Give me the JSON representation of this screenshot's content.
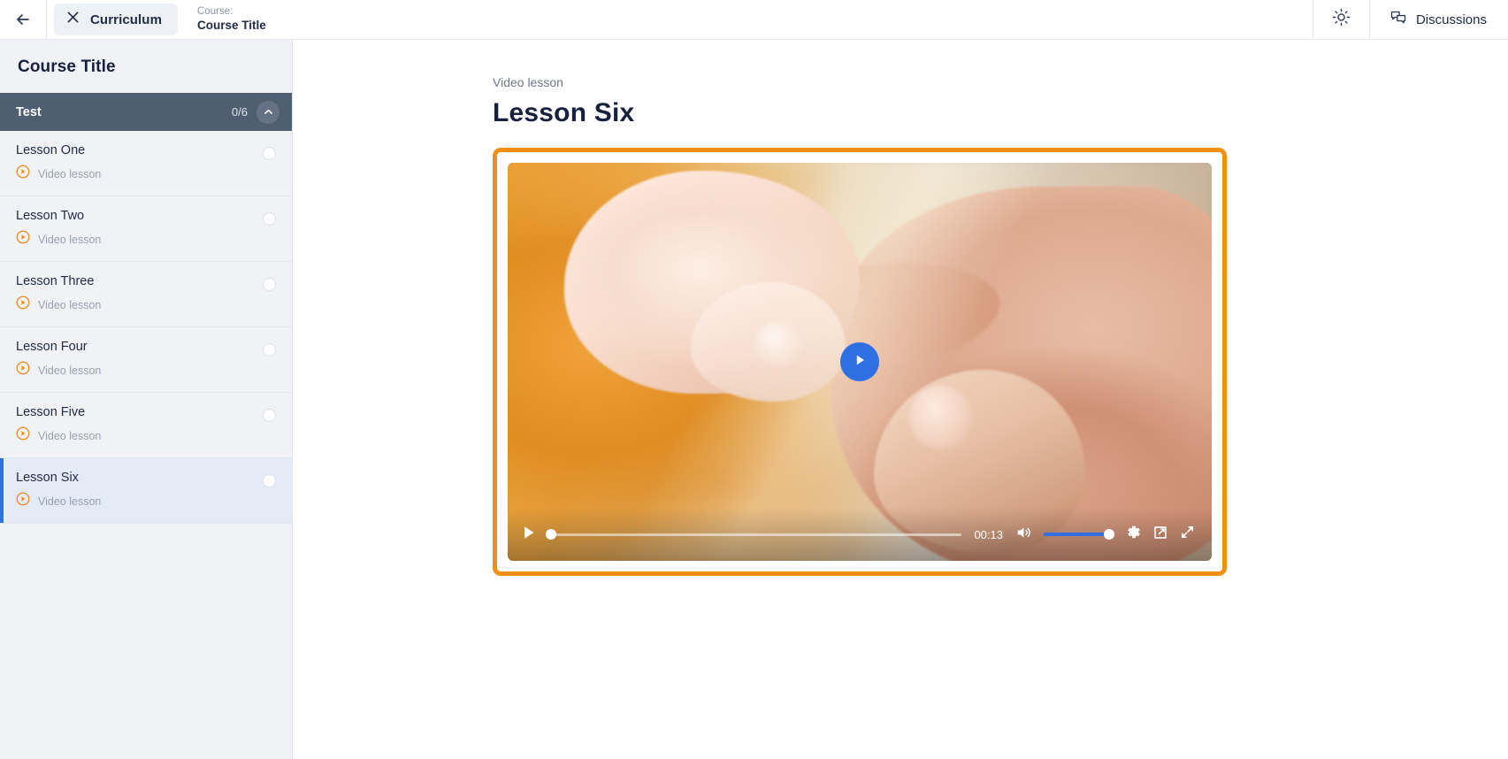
{
  "header": {
    "back_icon": "arrow-left-icon",
    "curriculum": {
      "label": "Curriculum",
      "icon": "close-x-icon"
    },
    "course_label": "Course:",
    "course_title": "Course Title",
    "brightness_icon": "sun-brightness-icon",
    "discussions": {
      "label": "Discussions",
      "icon": "chat-bubbles-icon"
    }
  },
  "sidebar": {
    "title": "Course Title",
    "section": {
      "name": "Test",
      "progress": "0/6",
      "chevron": "chevron-up-icon"
    },
    "lessons": [
      {
        "title": "Lesson One",
        "type": "Video lesson",
        "icon": "play-circle-icon",
        "completed": false,
        "active": false
      },
      {
        "title": "Lesson Two",
        "type": "Video lesson",
        "icon": "play-circle-icon",
        "completed": false,
        "active": false
      },
      {
        "title": "Lesson Three",
        "type": "Video lesson",
        "icon": "play-circle-icon",
        "completed": false,
        "active": false
      },
      {
        "title": "Lesson Four",
        "type": "Video lesson",
        "icon": "play-circle-icon",
        "completed": false,
        "active": false
      },
      {
        "title": "Lesson Five",
        "type": "Video lesson",
        "icon": "play-circle-icon",
        "completed": false,
        "active": false
      },
      {
        "title": "Lesson Six",
        "type": "Video lesson",
        "icon": "play-circle-icon",
        "completed": false,
        "active": true
      }
    ]
  },
  "main": {
    "eyebrow": "Video lesson",
    "heading": "Lesson Six",
    "player": {
      "play_overlay_icon": "play-triangle-icon",
      "play_button_icon": "play-triangle-icon",
      "current_time": "00:13",
      "progress_percent": 1,
      "volume_percent": 100,
      "mute_icon": "volume-high-icon",
      "settings_icon": "gear-icon",
      "pip_icon": "picture-in-picture-icon",
      "fullscreen_icon": "fullscreen-expand-icon"
    }
  },
  "colors": {
    "accent_blue": "#2f6fe4",
    "highlight_orange": "#ef8f14",
    "section_header": "#4f5e71",
    "sidebar_bg": "#f0f2f6",
    "lesson_icon_orange": "#f08c1e",
    "text_dark": "#16213d"
  }
}
